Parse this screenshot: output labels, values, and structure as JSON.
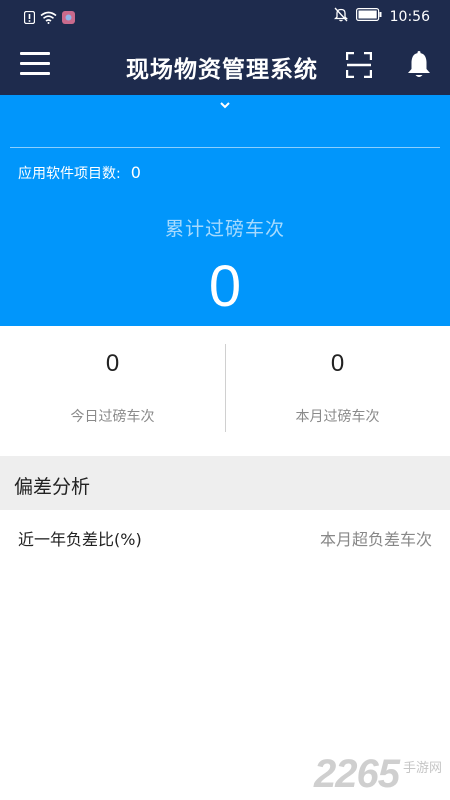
{
  "status_bar": {
    "time": "10:56",
    "icons": [
      "alert-icon",
      "wifi-icon",
      "app-notification-icon",
      "mute-icon",
      "battery-icon"
    ]
  },
  "app_bar": {
    "title": "现场物资管理系统",
    "icons": [
      "menu-icon",
      "scan-icon",
      "bell-icon"
    ],
    "background": "#1e2b4d"
  },
  "summary_panel": {
    "background": "#0196fb",
    "collapse_icon": "chevron-down-icon",
    "project_label": "应用软件项目数:",
    "project_count": "0",
    "cumulative_label": "累计过磅车次",
    "cumulative_value": "0"
  },
  "stats": [
    {
      "value": "0",
      "label": "今日过磅车次"
    },
    {
      "value": "0",
      "label": "本月过磅车次"
    }
  ],
  "deviation": {
    "section_title": "偏差分析",
    "left_label": "近一年负差比(%)",
    "right_label": "本月超负差车次"
  },
  "watermark": {
    "number": "2265",
    "text": "手游网"
  }
}
